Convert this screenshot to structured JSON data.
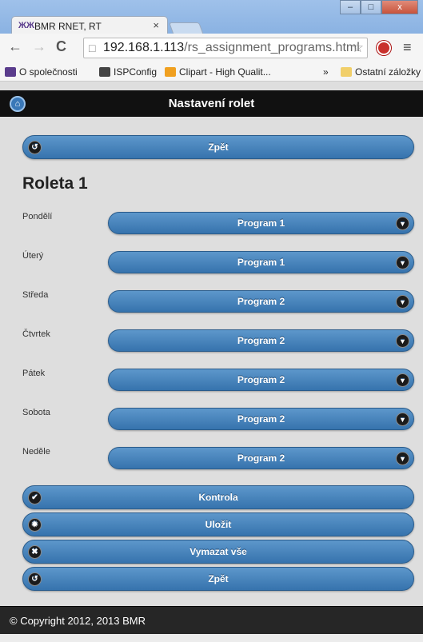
{
  "browser": {
    "tab_logo": "ЖЖ",
    "tab_title": "BMR RNET, RT",
    "tab_close": "×",
    "url_host": "192.168.1.113",
    "url_path": "/rs_assignment_programs.html",
    "nav_back": "←",
    "nav_forward": "→",
    "nav_reload": "C",
    "star_glyph": "☆",
    "menu_glyph": "≡",
    "window_min": "–",
    "window_max": "□",
    "window_close": "x"
  },
  "bookmarks": {
    "items": [
      {
        "label": "O společnosti",
        "color": "#5a3c8c"
      },
      {
        "label": "ISPConfig",
        "color": "#444444"
      },
      {
        "label": "Clipart - High Qualit...",
        "color": "#f0a020"
      }
    ],
    "overflow": "»",
    "other_label": "Ostatní záložky"
  },
  "header": {
    "title": "Nastavení rolet",
    "home_glyph": "⌂"
  },
  "main": {
    "back_top_label": "Zpět",
    "heading": "Roleta 1",
    "days": [
      {
        "day": "Pondělí",
        "program": "Program 1"
      },
      {
        "day": "Úterý",
        "program": "Program 1"
      },
      {
        "day": "Středa",
        "program": "Program 2"
      },
      {
        "day": "Čtvrtek",
        "program": "Program 2"
      },
      {
        "day": "Pátek",
        "program": "Program 2"
      },
      {
        "day": "Sobota",
        "program": "Program 2"
      },
      {
        "day": "Neděle",
        "program": "Program 2"
      }
    ],
    "chevron_glyph": "▼",
    "actions": {
      "check": "Kontrola",
      "save": "Uložit",
      "clear": "Vymazat vše",
      "back": "Zpět"
    },
    "icons": {
      "back": "↺",
      "check": "✔",
      "gear": "✹",
      "delete": "✖"
    }
  },
  "footer": {
    "copyright": "© Copyright 2012, 2013 BMR"
  },
  "colors": {
    "button_top": "#5d97cb",
    "button_bottom": "#3673ad",
    "header_bg": "#111111",
    "page_bg": "#dedede"
  }
}
